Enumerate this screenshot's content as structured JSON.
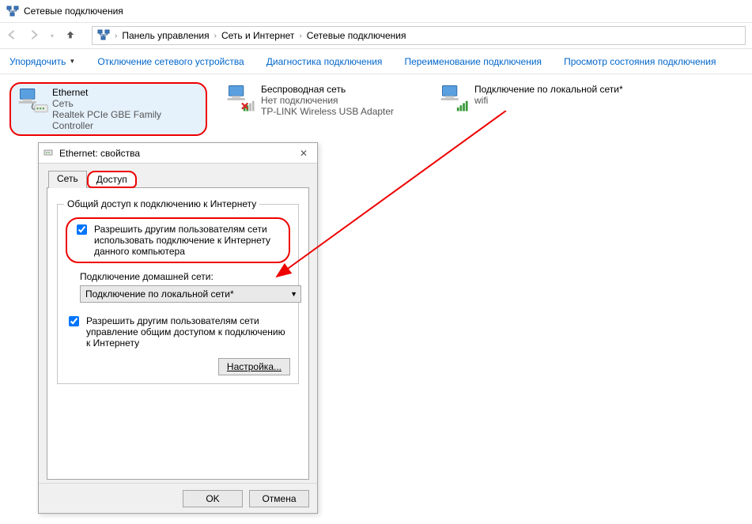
{
  "title": "Сетевые подключения",
  "breadcrumbs": {
    "root": "Панель управления",
    "mid": "Сеть и Интернет",
    "leaf": "Сетевые подключения"
  },
  "toolbar": {
    "organize": "Упорядочить",
    "disable": "Отключение сетевого устройства",
    "diag": "Диагностика подключения",
    "rename": "Переименование подключения",
    "status": "Просмотр состояния подключения"
  },
  "connections": [
    {
      "name": "Ethernet",
      "status": "Сеть",
      "device": "Realtek PCIe GBE Family Controller",
      "selected": true,
      "state": "eth"
    },
    {
      "name": "Беспроводная сеть",
      "status": "Нет подключения",
      "device": "TP-LINK Wireless USB Adapter",
      "selected": false,
      "state": "wifi-off"
    },
    {
      "name": "Подключение по локальной сети*",
      "status": "wifi",
      "device": "",
      "selected": false,
      "state": "wifi-on"
    }
  ],
  "dialog": {
    "title": "Ethernet: свойства",
    "tabs": {
      "network": "Сеть",
      "access": "Доступ"
    },
    "group_legend": "Общий доступ к подключению к Интернету",
    "check1": "Разрешить другим пользователям сети использовать подключение к Интернету данного компьютера",
    "home_label": "Подключение домашней сети:",
    "home_value": "Подключение по локальной сети*",
    "check2": "Разрешить другим пользователям сети управление общим доступом к подключению к Интернету",
    "settings_btn": "Настройка...",
    "ok": "OK",
    "cancel": "Отмена"
  }
}
